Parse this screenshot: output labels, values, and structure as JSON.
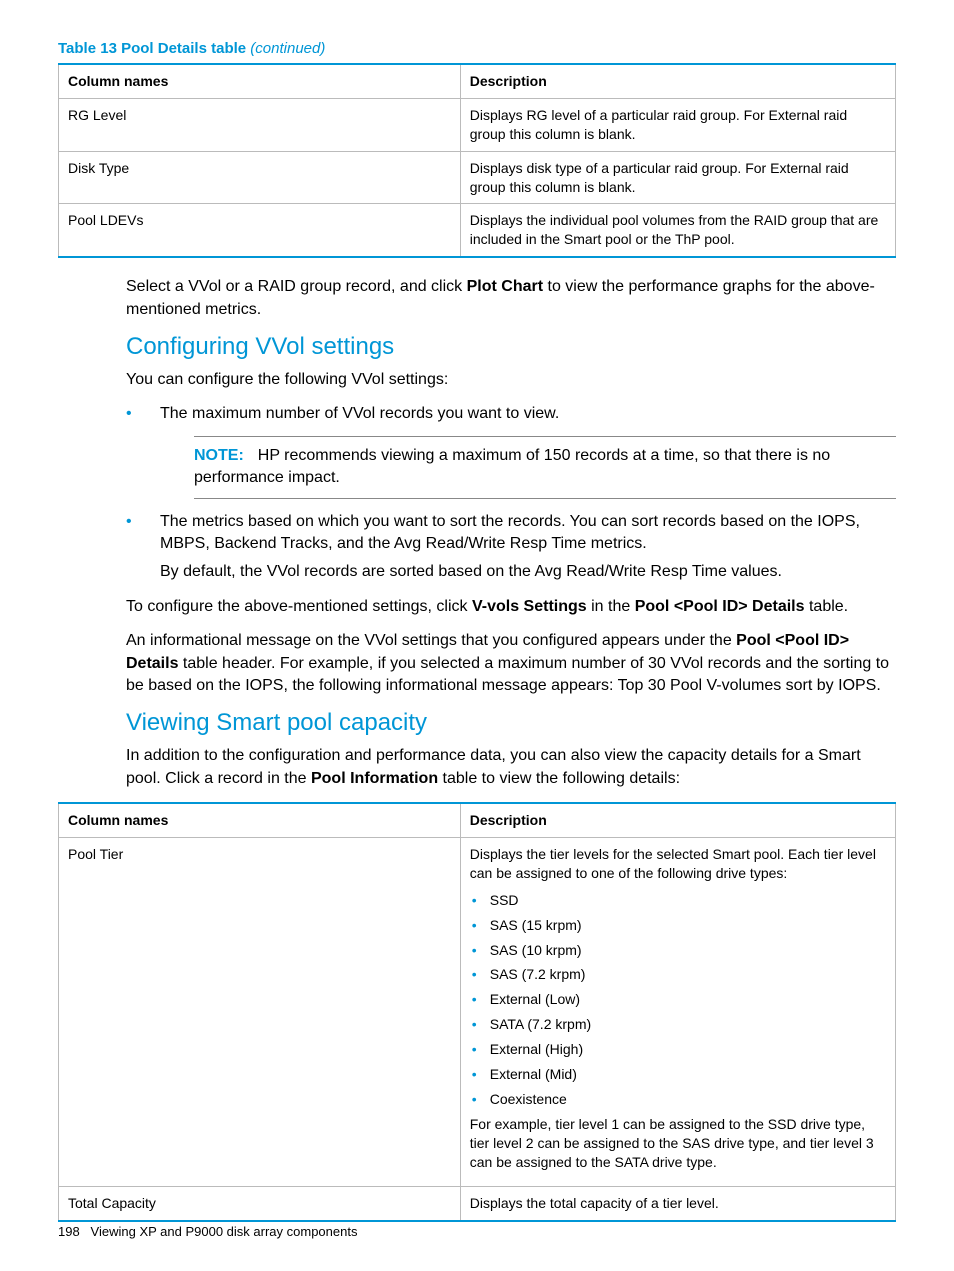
{
  "caption1_prefix": "Table 13 Pool Details table",
  "caption1_suffix": "(continued)",
  "table1": {
    "headers": [
      "Column names",
      "Description"
    ],
    "rows": [
      {
        "name": "RG Level",
        "desc": "Displays RG level of a particular raid group. For External raid group this column is blank."
      },
      {
        "name": "Disk Type",
        "desc": "Displays disk type of a particular raid group. For External raid group this column is blank."
      },
      {
        "name": "Pool LDEVs",
        "desc": "Displays the individual pool volumes from the RAID group that are included in the Smart pool or the ThP pool."
      }
    ]
  },
  "para1_a": "Select a VVol or a RAID group record, and click ",
  "para1_bold": "Plot Chart",
  "para1_b": " to view the performance graphs for the above-mentioned metrics.",
  "heading1": "Configuring VVol settings",
  "para2": "You can configure the following VVol settings:",
  "bullet1": "The maximum number of VVol records you want to view.",
  "note_label": "NOTE:",
  "note_text": "HP recommends viewing a maximum of 150 records at a time, so that there is no performance impact.",
  "bullet2_main": "The metrics based on which you want to sort the records. You can sort records based on the IOPS, MBPS, Backend Tracks, and the Avg Read/Write Resp Time metrics.",
  "bullet2_sub": "By default, the VVol records are sorted based on the Avg Read/Write Resp Time values.",
  "para3_a": "To configure the above-mentioned settings, click ",
  "para3_b1": "V-vols Settings",
  "para3_b": " in the ",
  "para3_b2": "Pool <Pool ID> Details",
  "para3_c": " table.",
  "para4_a": "An informational message on the VVol settings that you configured appears under the ",
  "para4_b1": "Pool <Pool ID> Details",
  "para4_b": " table header. For example, if you selected a maximum number of 30 VVol records and the sorting to be based on the IOPS, the following informational message appears: Top 30 Pool V-volumes sort by IOPS.",
  "heading2": "Viewing Smart pool capacity",
  "para5_a": "In addition to the configuration and performance data, you can also view the capacity details for a Smart pool. Click a record in the ",
  "para5_b1": "Pool Information",
  "para5_b": " table to view the following details:",
  "table2": {
    "headers": [
      "Column names",
      "Description"
    ],
    "row1_name": "Pool Tier",
    "row1_desc1": "Displays the tier levels for the selected Smart pool. Each tier level can be assigned to one of the following drive types:",
    "row1_items": [
      "SSD",
      "SAS (15 krpm)",
      "SAS (10 krpm)",
      "SAS (7.2 krpm)",
      "External (Low)",
      "SATA (7.2 krpm)",
      "External (High)",
      "External (Mid)",
      "Coexistence"
    ],
    "row1_desc2": "For example, tier level 1 can be assigned to the SSD drive type, tier level 2 can be assigned to the SAS drive type, and tier level 3 can be assigned to the SATA drive type.",
    "row2_name": "Total Capacity",
    "row2_desc": "Displays the total capacity of a tier level."
  },
  "footer_page": "198",
  "footer_text": "Viewing XP and P9000 disk array components"
}
